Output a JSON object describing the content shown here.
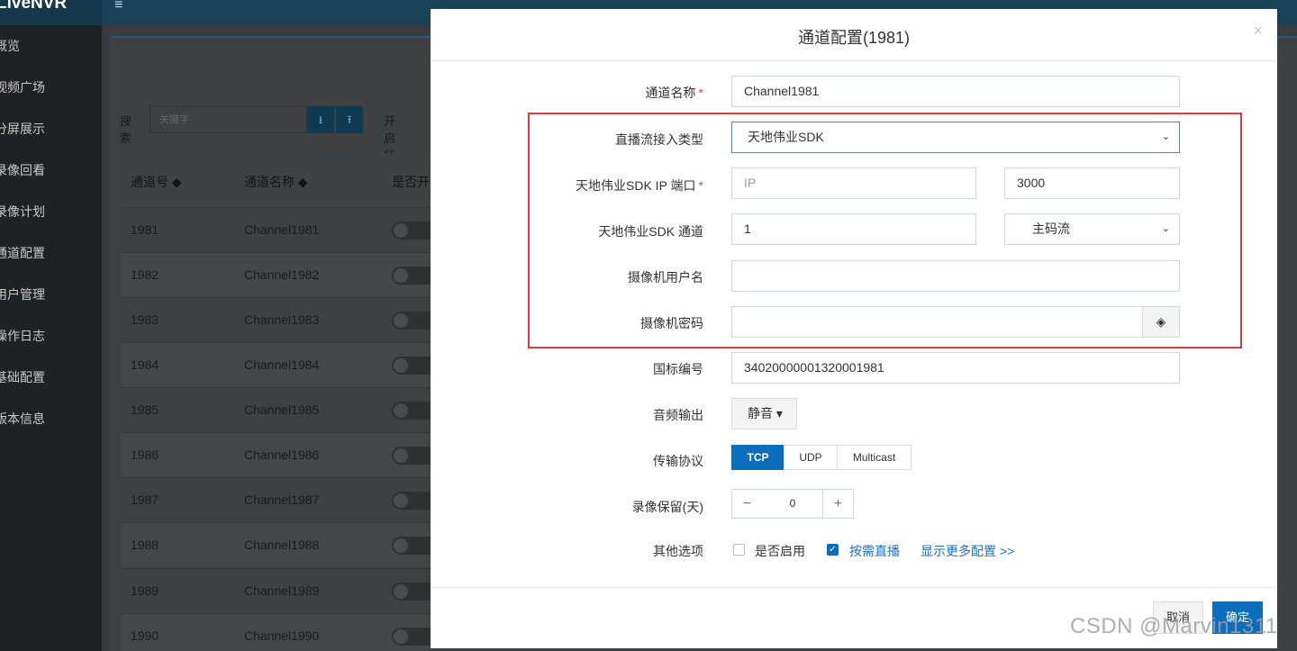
{
  "app": {
    "brand": "LiveNVR",
    "menu_icon": "hamburger-icon"
  },
  "sidebar": {
    "items": [
      {
        "label": "概览"
      },
      {
        "label": "视频广场"
      },
      {
        "label": "分屏展示"
      },
      {
        "label": "录像回看"
      },
      {
        "label": "录像计划"
      },
      {
        "label": "通道配置"
      },
      {
        "label": "用户管理"
      },
      {
        "label": "操作日志"
      },
      {
        "label": "基础配置"
      },
      {
        "label": "版本信息"
      }
    ]
  },
  "toolbar": {
    "search_label": "搜索",
    "search_placeholder": "关键字",
    "download_icon": "download-icon",
    "upload_icon": "upload-icon",
    "state_label": "开启状态"
  },
  "table": {
    "headers": [
      "通道号 ◆",
      "通道名称 ◆",
      "是否开"
    ],
    "rows": [
      {
        "id": "1981",
        "name": "Channel1981"
      },
      {
        "id": "1982",
        "name": "Channel1982"
      },
      {
        "id": "1983",
        "name": "Channel1983"
      },
      {
        "id": "1984",
        "name": "Channel1984"
      },
      {
        "id": "1985",
        "name": "Channel1985"
      },
      {
        "id": "1986",
        "name": "Channel1986"
      },
      {
        "id": "1987",
        "name": "Channel1987"
      },
      {
        "id": "1988",
        "name": "Channel1988"
      },
      {
        "id": "1989",
        "name": "Channel1989"
      },
      {
        "id": "1990",
        "name": "Channel1990"
      }
    ]
  },
  "modal": {
    "title": "通道配置(1981)",
    "close": "×",
    "fields": {
      "channel_name": {
        "label": "通道名称",
        "required": "*",
        "value": "Channel1981"
      },
      "stream_type": {
        "label": "直播流接入类型",
        "value": "天地伟业SDK"
      },
      "sdk_ip_port": {
        "label": "天地伟业SDK IP 端口",
        "required": "*",
        "ip_placeholder": "IP",
        "port_value": "3000"
      },
      "sdk_channel": {
        "label": "天地伟业SDK 通道",
        "value": "1",
        "stream_value": "主码流"
      },
      "camera_user": {
        "label": "摄像机用户名",
        "value": ""
      },
      "camera_password": {
        "label": "摄像机密码",
        "value": "",
        "toggle_icon": "eye-slash-icon"
      },
      "gb_id": {
        "label": "国标编号",
        "value": "34020000001320001981"
      },
      "audio_output": {
        "label": "音频输出",
        "value": "静音 ▾"
      },
      "protocol": {
        "label": "传输协议",
        "options": [
          "TCP",
          "UDP",
          "Multicast"
        ],
        "selected": "TCP"
      },
      "record_days": {
        "label": "录像保留(天)",
        "minus": "−",
        "value": "0",
        "plus": "+"
      },
      "other_options": {
        "label": "其他选项",
        "enabled_label": "是否启用",
        "enabled": false,
        "on_demand_label": "按需直播",
        "on_demand": true,
        "more_link": "显示更多配置 >>"
      }
    },
    "footer": {
      "cancel": "取消",
      "ok": "确定"
    }
  },
  "watermark": "CSDN @Marvin1311",
  "colors": {
    "primary": "#0a6ebd",
    "highlight": "#e53935",
    "topbar": "#1a4257"
  }
}
